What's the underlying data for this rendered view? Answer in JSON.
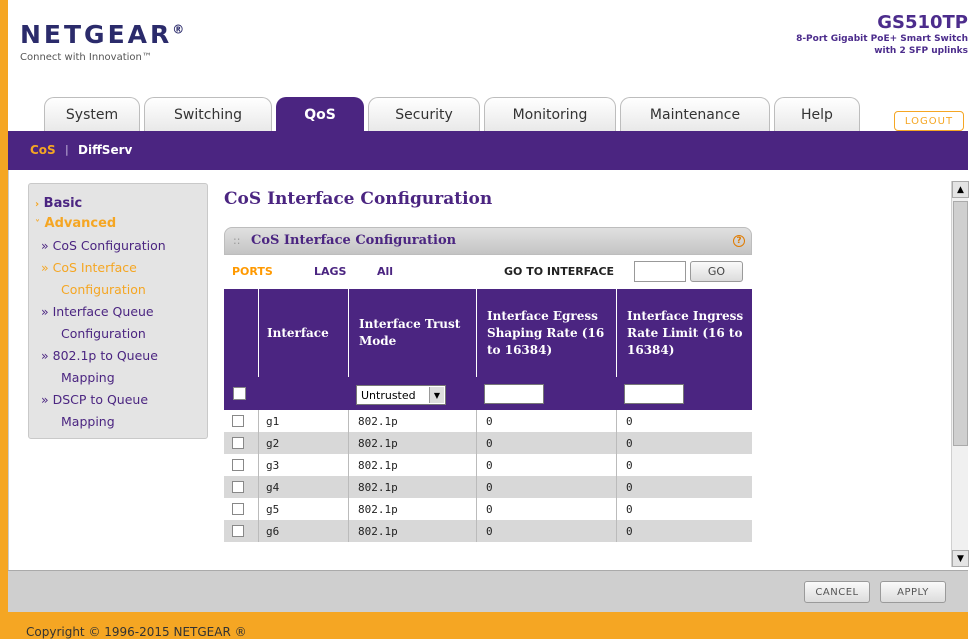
{
  "header": {
    "logo": "NETGEAR",
    "logo_mark": "®",
    "tagline": "Connect with Innovation™",
    "model": "GS510TP",
    "model_desc_1": "8-Port Gigabit PoE+ Smart Switch",
    "model_desc_2": "with 2 SFP uplinks",
    "logout": "LOGOUT"
  },
  "tabs": [
    {
      "label": "System"
    },
    {
      "label": "Switching"
    },
    {
      "label": "QoS"
    },
    {
      "label": "Security"
    },
    {
      "label": "Monitoring"
    },
    {
      "label": "Maintenance"
    },
    {
      "label": "Help"
    }
  ],
  "subnav": {
    "cos": "CoS",
    "sep": "|",
    "diffserv": "DiffServ"
  },
  "side": {
    "basic": "Basic",
    "advanced": "Advanced",
    "items": [
      "» CoS Configuration",
      "» CoS Interface",
      "Configuration",
      "» Interface Queue",
      "Configuration",
      "» 802.1p to Queue",
      "Mapping",
      "» DSCP to Queue",
      "Mapping"
    ]
  },
  "main": {
    "page_title": "CoS Interface Configuration",
    "panel_title": "CoS Interface Configuration",
    "help": "?",
    "filters": {
      "ports": "PORTS",
      "lags": "LAGS",
      "all": "All"
    },
    "goto_label": "GO TO INTERFACE",
    "go_button": "GO",
    "columns": [
      "Interface",
      "Interface Trust Mode",
      "Interface Egress Shaping Rate (16 to 16384)",
      "Interface Ingress Rate Limit (16 to 16384)"
    ],
    "trust_select": "Untrusted",
    "rows": [
      {
        "interface": "g1",
        "mode": "802.1p",
        "egress": "0",
        "ingress": "0"
      },
      {
        "interface": "g2",
        "mode": "802.1p",
        "egress": "0",
        "ingress": "0"
      },
      {
        "interface": "g3",
        "mode": "802.1p",
        "egress": "0",
        "ingress": "0"
      },
      {
        "interface": "g4",
        "mode": "802.1p",
        "egress": "0",
        "ingress": "0"
      },
      {
        "interface": "g5",
        "mode": "802.1p",
        "egress": "0",
        "ingress": "0"
      },
      {
        "interface": "g6",
        "mode": "802.1p",
        "egress": "0",
        "ingress": "0"
      }
    ]
  },
  "buttons": {
    "cancel": "CANCEL",
    "apply": "APPLY"
  },
  "footer": "Copyright © 1996-2015 NETGEAR ®",
  "colors": {
    "purple": "#4b2581",
    "orange": "#f5a623",
    "highlight": "#ff9900"
  }
}
